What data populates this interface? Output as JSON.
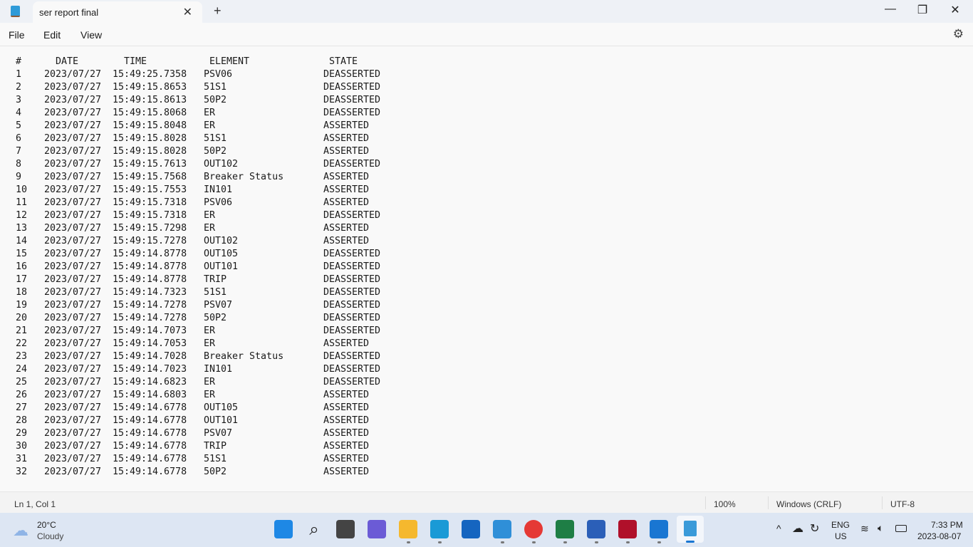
{
  "window": {
    "tab_title": "ser report final",
    "new_tab": "+",
    "close_tab": "✕",
    "minimize": "—",
    "maximize": "❐",
    "close": "✕"
  },
  "menu": {
    "file": "File",
    "edit": "Edit",
    "view": "View"
  },
  "document": {
    "headers": [
      "#",
      "DATE",
      "TIME",
      "ELEMENT",
      "STATE"
    ],
    "rows": [
      [
        "1",
        "2023/07/27",
        "15:49:25.7358",
        "PSV06",
        "DEASSERTED"
      ],
      [
        "2",
        "2023/07/27",
        "15:49:15.8653",
        "51S1",
        "DEASSERTED"
      ],
      [
        "3",
        "2023/07/27",
        "15:49:15.8613",
        "50P2",
        "DEASSERTED"
      ],
      [
        "4",
        "2023/07/27",
        "15:49:15.8068",
        "ER",
        "DEASSERTED"
      ],
      [
        "5",
        "2023/07/27",
        "15:49:15.8048",
        "ER",
        "ASSERTED"
      ],
      [
        "6",
        "2023/07/27",
        "15:49:15.8028",
        "51S1",
        "ASSERTED"
      ],
      [
        "7",
        "2023/07/27",
        "15:49:15.8028",
        "50P2",
        "ASSERTED"
      ],
      [
        "8",
        "2023/07/27",
        "15:49:15.7613",
        "OUT102",
        "DEASSERTED"
      ],
      [
        "9",
        "2023/07/27",
        "15:49:15.7568",
        "Breaker Status",
        "ASSERTED"
      ],
      [
        "10",
        "2023/07/27",
        "15:49:15.7553",
        "IN101",
        "ASSERTED"
      ],
      [
        "11",
        "2023/07/27",
        "15:49:15.7318",
        "PSV06",
        "ASSERTED"
      ],
      [
        "12",
        "2023/07/27",
        "15:49:15.7318",
        "ER",
        "DEASSERTED"
      ],
      [
        "13",
        "2023/07/27",
        "15:49:15.7298",
        "ER",
        "ASSERTED"
      ],
      [
        "14",
        "2023/07/27",
        "15:49:15.7278",
        "OUT102",
        "ASSERTED"
      ],
      [
        "15",
        "2023/07/27",
        "15:49:14.8778",
        "OUT105",
        "DEASSERTED"
      ],
      [
        "16",
        "2023/07/27",
        "15:49:14.8778",
        "OUT101",
        "DEASSERTED"
      ],
      [
        "17",
        "2023/07/27",
        "15:49:14.8778",
        "TRIP",
        "DEASSERTED"
      ],
      [
        "18",
        "2023/07/27",
        "15:49:14.7323",
        "51S1",
        "DEASSERTED"
      ],
      [
        "19",
        "2023/07/27",
        "15:49:14.7278",
        "PSV07",
        "DEASSERTED"
      ],
      [
        "20",
        "2023/07/27",
        "15:49:14.7278",
        "50P2",
        "DEASSERTED"
      ],
      [
        "21",
        "2023/07/27",
        "15:49:14.7073",
        "ER",
        "DEASSERTED"
      ],
      [
        "22",
        "2023/07/27",
        "15:49:14.7053",
        "ER",
        "ASSERTED"
      ],
      [
        "23",
        "2023/07/27",
        "15:49:14.7028",
        "Breaker Status",
        "DEASSERTED"
      ],
      [
        "24",
        "2023/07/27",
        "15:49:14.7023",
        "IN101",
        "DEASSERTED"
      ],
      [
        "25",
        "2023/07/27",
        "15:49:14.6823",
        "ER",
        "DEASSERTED"
      ],
      [
        "26",
        "2023/07/27",
        "15:49:14.6803",
        "ER",
        "ASSERTED"
      ],
      [
        "27",
        "2023/07/27",
        "15:49:14.6778",
        "OUT105",
        "ASSERTED"
      ],
      [
        "28",
        "2023/07/27",
        "15:49:14.6778",
        "OUT101",
        "ASSERTED"
      ],
      [
        "29",
        "2023/07/27",
        "15:49:14.6778",
        "PSV07",
        "ASSERTED"
      ],
      [
        "30",
        "2023/07/27",
        "15:49:14.6778",
        "TRIP",
        "ASSERTED"
      ],
      [
        "31",
        "2023/07/27",
        "15:49:14.6778",
        "51S1",
        "ASSERTED"
      ],
      [
        "32",
        "2023/07/27",
        "15:49:14.6778",
        "50P2",
        "ASSERTED"
      ]
    ]
  },
  "status": {
    "position": "Ln 1, Col 1",
    "zoom": "100%",
    "line_ending": "Windows (CRLF)",
    "encoding": "UTF-8"
  },
  "taskbar": {
    "temp": "20°C",
    "weather": "Cloudy",
    "lang1": "ENG",
    "lang2": "US",
    "time": "7:33 PM",
    "date": "2023-08-07",
    "apps": [
      "start",
      "search",
      "task-view",
      "teams",
      "file-explorer",
      "edge",
      "store",
      "photos",
      "chrome",
      "excel",
      "word",
      "acrobat",
      "mail",
      "notepad"
    ],
    "colors": [
      "#1e88e5",
      "#222222",
      "#444444",
      "#6b5bd6",
      "#f5b82e",
      "#1a9ad6",
      "#1565c0",
      "#2f8fd8",
      "#e53935",
      "#1e7e45",
      "#2b5fb8",
      "#b0102a",
      "#1976d2",
      "#3a9ad9"
    ]
  }
}
